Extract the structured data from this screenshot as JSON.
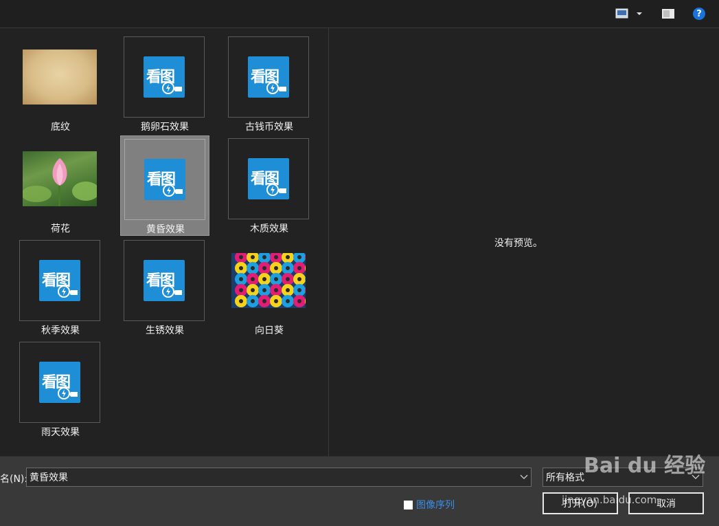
{
  "toolbar": {
    "view_icon": "view-thumbnails-icon",
    "pane_icon": "preview-pane-icon",
    "help_label": "?"
  },
  "files": [
    {
      "name": "底纹",
      "type": "texture"
    },
    {
      "name": "鹅卵石效果",
      "type": "kantu"
    },
    {
      "name": "古钱币效果",
      "type": "kantu"
    },
    {
      "name": "荷花",
      "type": "lotus"
    },
    {
      "name": "黄昏效果",
      "type": "kantu",
      "selected": true
    },
    {
      "name": "木质效果",
      "type": "kantu"
    },
    {
      "name": "秋季效果",
      "type": "kantu"
    },
    {
      "name": "生锈效果",
      "type": "kantu"
    },
    {
      "name": "向日葵",
      "type": "flowers"
    },
    {
      "name": "雨天效果",
      "type": "kantu"
    }
  ],
  "kantu_icon_text": "看图",
  "preview": {
    "message": "没有预览。"
  },
  "footer": {
    "filename_label": "名(N):",
    "filename_value": "黄昏效果",
    "filetype_value": "所有格式",
    "sequence_label": "图像序列",
    "open_label": "打开(O)",
    "cancel_label": "取消"
  },
  "watermark": {
    "brand": "Bai du 经验",
    "url": "jingyan.baidu.com"
  },
  "colors": {
    "accent": "#1a73d9",
    "kantu_blue": "#1e8fd6",
    "link": "#3a8ee6"
  }
}
